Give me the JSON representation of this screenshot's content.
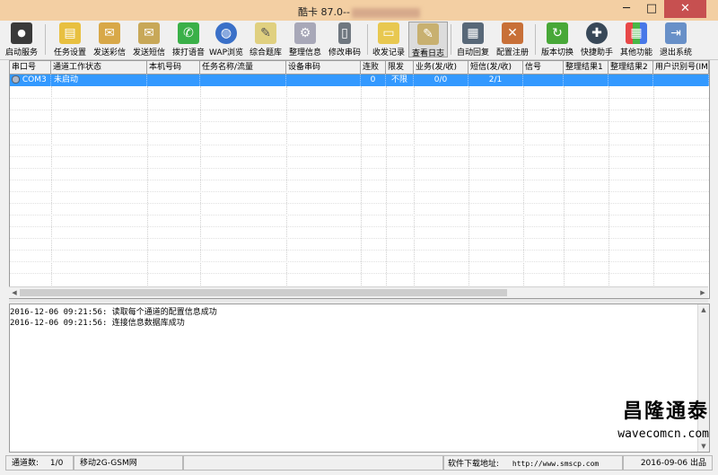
{
  "window": {
    "title": "酷卡 87.0--",
    "min": "─",
    "max": "□",
    "close": "✕"
  },
  "toolbar": {
    "items": [
      {
        "label": "启动服务",
        "icon": "traffic-light-icon"
      },
      {
        "label": "任务设置",
        "icon": "task-settings-icon"
      },
      {
        "label": "发送彩信",
        "icon": "mms-icon"
      },
      {
        "label": "发送短信",
        "icon": "sms-icon"
      },
      {
        "label": "拨打语音",
        "icon": "phone-icon"
      },
      {
        "label": "WAP浏览",
        "icon": "globe-icon"
      },
      {
        "label": "综合题库",
        "icon": "notebook-icon"
      },
      {
        "label": "整理信息",
        "icon": "gears-icon"
      },
      {
        "label": "修改串码",
        "icon": "cellphone-icon"
      },
      {
        "label": "收发记录",
        "icon": "record-icon"
      },
      {
        "label": "查看日志",
        "icon": "log-icon"
      },
      {
        "label": "自动回复",
        "icon": "auto-reply-icon"
      },
      {
        "label": "配置注册",
        "icon": "tools-icon"
      },
      {
        "label": "版本切换",
        "icon": "refresh-icon"
      },
      {
        "label": "快捷助手",
        "icon": "shortcut-icon"
      },
      {
        "label": "其他功能",
        "icon": "tiles-icon"
      },
      {
        "label": "退出系统",
        "icon": "exit-icon"
      }
    ]
  },
  "grid": {
    "columns": [
      "串口号",
      "通道工作状态",
      "本机号码",
      "任务名称/流量",
      "设备串码",
      "连败",
      "限发",
      "业务(发/收)",
      "短信(发/收)",
      "信号",
      "整理结果1",
      "整理结果2",
      "用户识别号(IM"
    ],
    "rows": [
      [
        "COM3",
        "未启动",
        "",
        "",
        "",
        "0",
        "不限",
        "0/0",
        "2/1",
        "",
        "",
        "",
        ""
      ]
    ]
  },
  "log": {
    "lines": [
      "2016-12-06 09:21:56: 读取每个通道的配置信息成功",
      "2016-12-06 09:21:56: 连接信息数据库成功"
    ]
  },
  "watermark": {
    "title": "昌隆通泰",
    "url": "wavecomcn.com"
  },
  "status": {
    "channels_label": "通道数:",
    "channels_value": "1/0",
    "network": "移动2G-GSM网",
    "download_label": "软件下载地址:",
    "download_url": "http://www.smscp.com",
    "date": "2016-09-06 出品"
  },
  "colors": {
    "titlebar": "#f3cfa3",
    "selection": "#3399ff",
    "close": "#c75050"
  }
}
